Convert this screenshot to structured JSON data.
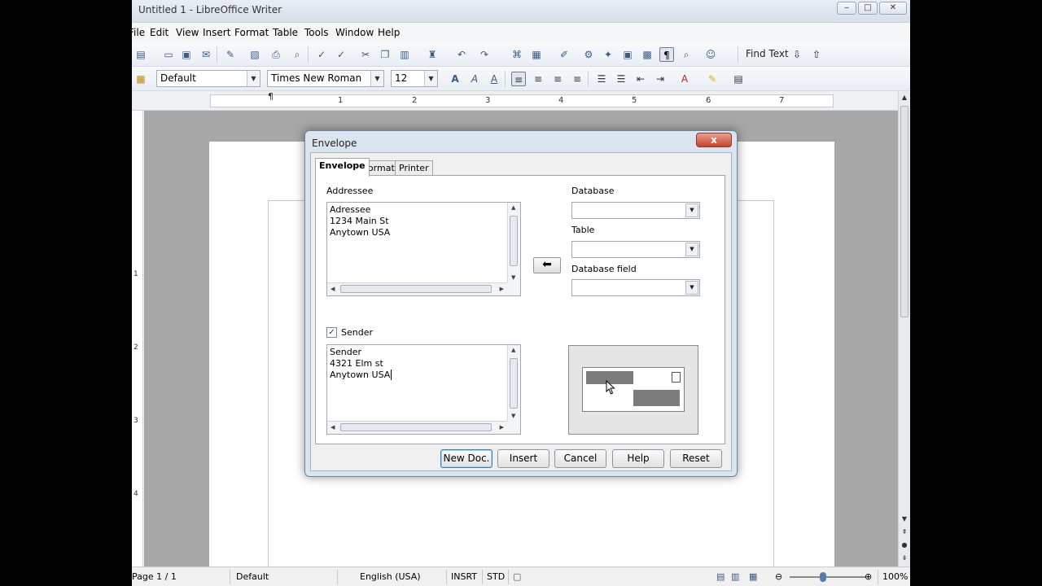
{
  "window": {
    "title": "Untitled 1 - LibreOffice Writer"
  },
  "menu": [
    "File",
    "Edit",
    "View",
    "Insert",
    "Format",
    "Table",
    "Tools",
    "Window",
    "Help"
  ],
  "toolbar": {
    "find_text": "Find Text"
  },
  "formatting": {
    "style": "Default",
    "font": "Times New Roman",
    "size": "12"
  },
  "ruler": {
    "numbers": [
      "1",
      "2",
      "3",
      "4",
      "5",
      "6",
      "7"
    ]
  },
  "vruler": {
    "numbers": [
      "1",
      "2",
      "3",
      "4"
    ]
  },
  "dialog": {
    "title": "Envelope",
    "close_glyph": "x",
    "tabs": [
      "Envelope",
      "Format",
      "Printer"
    ],
    "active_tab": "Envelope",
    "addressee_label": "Addressee",
    "addressee_lines": [
      "Adressee",
      "1234 Main St",
      "Anytown USA"
    ],
    "database_label": "Database",
    "table_label": "Table",
    "database_field_label": "Database field",
    "sender_label": "Sender",
    "sender_checked": true,
    "sender_lines": [
      "Sender",
      "4321 Elm st",
      "Anytown USA"
    ],
    "buttons": {
      "new_doc": "New Doc.",
      "insert": "Insert",
      "cancel": "Cancel",
      "help": "Help",
      "reset": "Reset"
    }
  },
  "status": {
    "page": "Page 1 / 1",
    "style": "Default",
    "language": "English (USA)",
    "insert_mode": "INSRT",
    "selection_mode": "STD",
    "zoom": "100%"
  }
}
